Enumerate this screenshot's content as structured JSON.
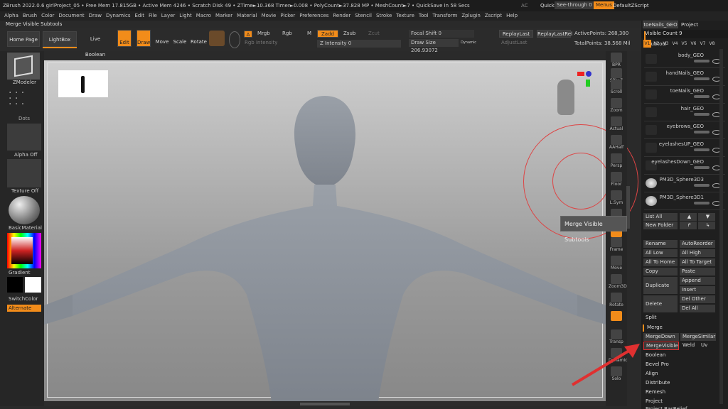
{
  "titlebar": {
    "text": "ZBrush 2022.0.6   girlProject_05   • Free Mem 17.815GB • Active Mem 4246 • Scratch Disk 49 •  ZTime►10.368 Timer►0.008 • PolyCount►37.828 MP  • MeshCount►7  • QuickSave In 58 Secs",
    "ac": "AC",
    "quicksave": "QuickSave",
    "seethrough": "See-through  0",
    "menus": "Menus",
    "script": "DefaultZScript"
  },
  "menus": [
    "Alpha",
    "Brush",
    "Color",
    "Document",
    "Draw",
    "Dynamics",
    "Edit",
    "File",
    "Layer",
    "Light",
    "Macro",
    "Marker",
    "Material",
    "Movie",
    "Picker",
    "Preferences",
    "Render",
    "Stencil",
    "Stroke",
    "Texture",
    "Tool",
    "Transform",
    "Zplugin",
    "Zscript",
    "Help"
  ],
  "toolbar_title": "Merge Visible Subtools",
  "top": {
    "homepage": "Home Page",
    "lightbox": "LightBox",
    "liveboolean": "Live Boolean",
    "edit": "Edit",
    "draw": "Draw",
    "move": "Move",
    "scale": "Scale",
    "rotate": "Rotate",
    "a": "A",
    "mrgb": "Mrgb",
    "rgb": "Rgb",
    "m": "M",
    "zadd": "Zadd",
    "zsub": "Zsub",
    "zcut": "Zcut",
    "rgbint": "Rgb Intensity",
    "zint": "Z Intensity 0",
    "focal": "Focal Shift 0",
    "drawsize": "Draw Size 206.93072",
    "dynamic": "Dynamic",
    "replaylast": "ReplayLast",
    "replaylastrel": "ReplayLastRel",
    "adjustlast": "AdjustLast",
    "activepoints": "ActivePoints: 268,300",
    "totalpoints": "TotalPoints: 38.568 Mil"
  },
  "left": {
    "zmodeler": "ZModeler",
    "dots": "Dots",
    "alphaoff": "Alpha Off",
    "textureoff": "Texture Off",
    "basicmaterial": "BasicMaterial",
    "gradient": "Gradient",
    "switchcolor": "SwitchColor",
    "alternate": "Alternate"
  },
  "shelf": [
    "BPR",
    "SPix 7",
    "Scroll",
    "Zoom",
    "Actual",
    "AAHalf",
    "Persp",
    "Floor",
    "L.Sym",
    "Lock",
    "",
    "Frame",
    "Move",
    "Zoom3D",
    "Rotate",
    "",
    "Transp",
    "Dynamic",
    "Solo"
  ],
  "tooltip": "Merge Visible Subtools",
  "right": {
    "file": "toeNails_GEO",
    "project": "Project",
    "subtool": "Subtool",
    "visiblecount": "Visible Count 9",
    "vtabs": [
      "V1",
      "V2",
      "V3",
      "V4",
      "V5",
      "V6",
      "V7",
      "V8"
    ],
    "subtools": [
      "body_GEO",
      "handNails_GEO",
      "toeNails_GEO",
      "hair_GEO",
      "eyebrows_GEO",
      "eyelashesUP_GEO",
      "eyelashesDown_GEO",
      "PM3D_Sphere3D3",
      "PM3D_Sphere3D1"
    ],
    "listall": "List All",
    "newfolder": "New Folder",
    "rename": "Rename",
    "autoreorder": "AutoReorder",
    "alllow": "All Low",
    "allhigh": "All High",
    "alltohome": "All To Home",
    "alltotarget": "All To Target",
    "copy": "Copy",
    "paste": "Paste",
    "duplicate": "Duplicate",
    "append": "Append",
    "insert": "Insert",
    "delete": "Delete",
    "delother": "Del Other",
    "delall": "Del All",
    "split": "Split",
    "merge": "Merge",
    "mergedown": "MergeDown",
    "mergesimilar": "MergeSimilar",
    "mergevisible": "MergeVisible",
    "weld": "Weld",
    "uv": "Uv",
    "boolean": "Boolean",
    "bevelpro": "Bevel Pro",
    "align": "Align",
    "distribute": "Distribute",
    "remesh": "Remesh",
    "projectbas": "Project BasRelief"
  },
  "colors": {
    "accent": "#f28c1a",
    "highlight": "#e03030"
  }
}
